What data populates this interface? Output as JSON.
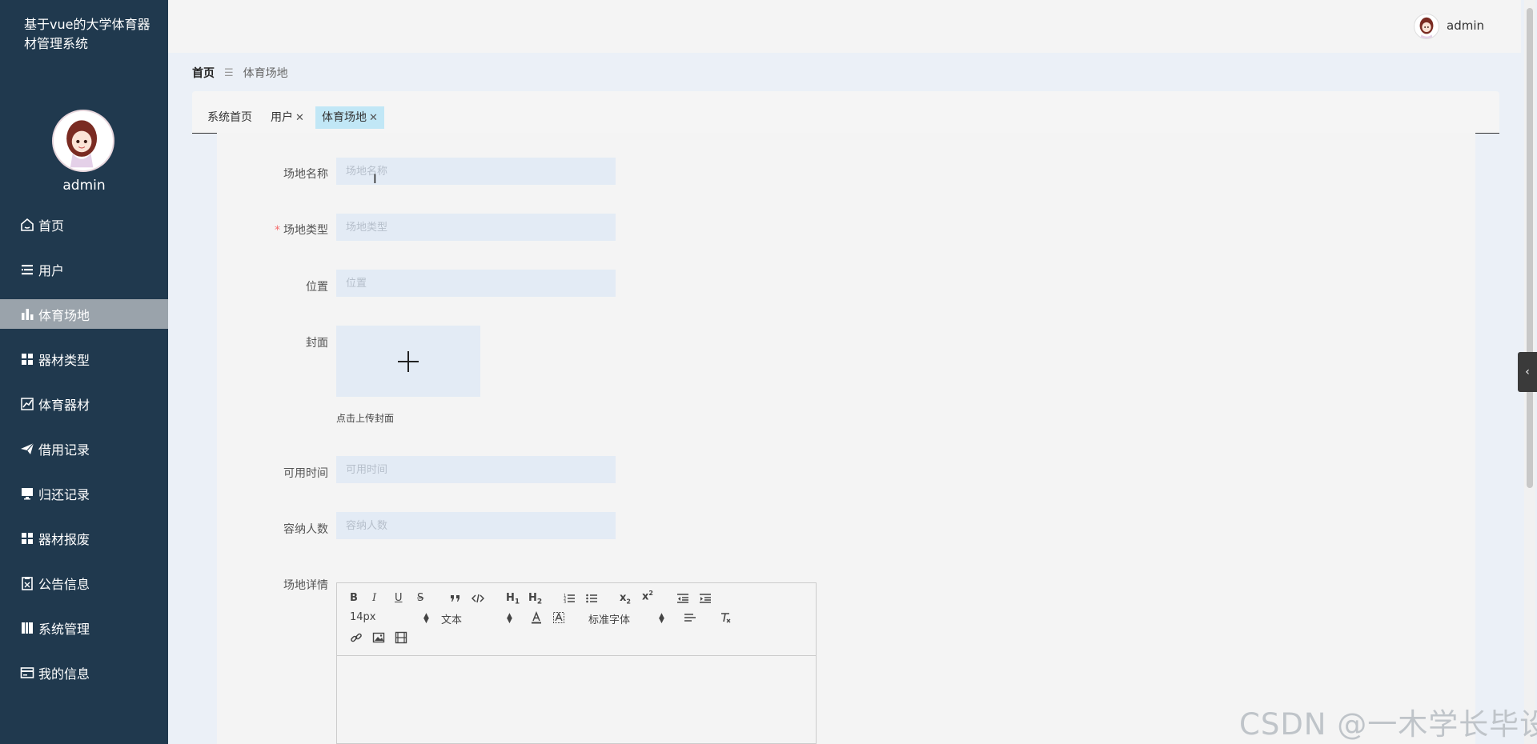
{
  "app": {
    "title": "基于vue的大学体育器材管理系统"
  },
  "sidebar": {
    "username": "admin",
    "items": [
      {
        "label": "首页",
        "icon": "home-icon"
      },
      {
        "label": "用户",
        "icon": "list-icon"
      },
      {
        "label": "体育场地",
        "icon": "bar-chart-icon",
        "active": true
      },
      {
        "label": "器材类型",
        "icon": "grid-icon"
      },
      {
        "label": "体育器材",
        "icon": "line-chart-icon"
      },
      {
        "label": "借用记录",
        "icon": "paper-plane-icon"
      },
      {
        "label": "归还记录",
        "icon": "monitor-icon"
      },
      {
        "label": "器材报废",
        "icon": "grid-icon"
      },
      {
        "label": "公告信息",
        "icon": "clipboard-icon"
      },
      {
        "label": "系统管理",
        "icon": "book-icon"
      },
      {
        "label": "我的信息",
        "icon": "card-icon"
      }
    ]
  },
  "topbar": {
    "username": "admin"
  },
  "breadcrumb": {
    "home": "首页",
    "current": "体育场地"
  },
  "tabs": [
    {
      "label": "系统首页",
      "closable": false
    },
    {
      "label": "用户",
      "closable": true
    },
    {
      "label": "体育场地",
      "closable": true,
      "active": true
    }
  ],
  "form": {
    "name": {
      "label": "场地名称",
      "placeholder": "场地名称",
      "value": ""
    },
    "type": {
      "label": "场地类型",
      "placeholder": "场地类型",
      "required": true,
      "value": ""
    },
    "location": {
      "label": "位置",
      "placeholder": "位置",
      "value": ""
    },
    "cover": {
      "label": "封面",
      "tip": "点击上传封面"
    },
    "available_time": {
      "label": "可用时间",
      "placeholder": "可用时间",
      "value": ""
    },
    "capacity": {
      "label": "容纳人数",
      "placeholder": "容纳人数",
      "value": ""
    },
    "details": {
      "label": "场地详情"
    }
  },
  "editor": {
    "font_size": "14px",
    "header": "文本",
    "font_family": "标准字体",
    "buttons": {
      "bold": "B",
      "italic": "I",
      "underline": "U",
      "strike": "S",
      "h1": "H1",
      "h2": "H2"
    }
  },
  "watermark": "CSDN @一木学长毕设",
  "colors": {
    "sidebar_bg": "#20394e",
    "active_menu": "#9aa3ab",
    "active_tab": "#c1e7f6",
    "required": "#f56c6c"
  }
}
